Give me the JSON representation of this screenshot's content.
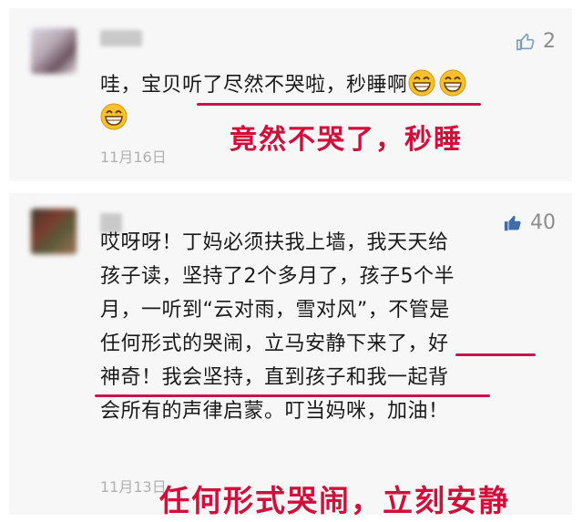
{
  "comments": [
    {
      "likes": "2",
      "text": "哇，宝贝听了尽然不哭啦，秒睡啊",
      "date": "11月16日",
      "annotation": "竟然不哭了，秒睡",
      "emoji_icon": "grin-emoji-icon",
      "like_icon": "thumbs-up-outline-icon"
    },
    {
      "likes": "40",
      "lines": [
        "哎呀呀！丁妈必须扶我上墙，我天天给",
        "孩子读，坚持了2个多月了，孩子5个半",
        "月，一听到“云对雨，雪对风”，不管是",
        "任何形式的哭闹，立马安静下来了，好",
        "神奇！我会坚持，直到孩子和我一起背",
        "会所有的声律启蒙。叮当妈咪，加油！"
      ],
      "date": "11月13日",
      "annotation": "任何形式哭闹，立刻安静",
      "like_icon": "thumbs-up-filled-icon"
    }
  ],
  "colors": {
    "annotation_red": "#d10f3a",
    "underline": "#c9154f",
    "like_liked": "#3d6ea8",
    "like_default": "#7f9dbd",
    "card_bg": "#f7f7f7"
  }
}
